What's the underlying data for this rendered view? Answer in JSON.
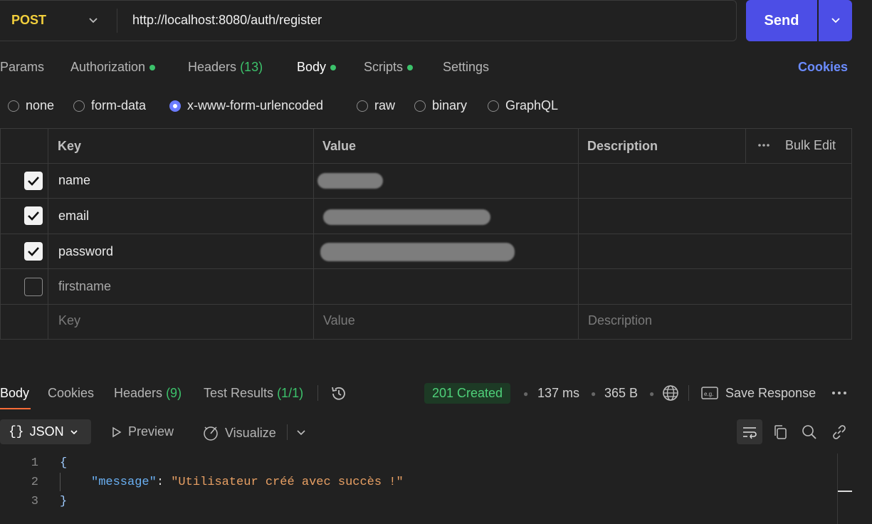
{
  "request": {
    "method": "POST",
    "url": "http://localhost:8080/auth/register",
    "send_label": "Send"
  },
  "request_tabs": [
    {
      "label": "Params"
    },
    {
      "label": "Authorization"
    },
    {
      "label": "Headers",
      "count": "(13)"
    },
    {
      "label": "Body"
    },
    {
      "label": "Scripts"
    },
    {
      "label": "Settings"
    }
  ],
  "cookies_label": "Cookies",
  "body_types": [
    "none",
    "form-data",
    "x-www-form-urlencoded",
    "raw",
    "binary",
    "GraphQL"
  ],
  "selected_body_type": "x-www-form-urlencoded",
  "table": {
    "headers": {
      "key": "Key",
      "value": "Value",
      "description": "Description",
      "bulk_edit": "Bulk Edit"
    },
    "rows": [
      {
        "checked": true,
        "key": "name"
      },
      {
        "checked": true,
        "key": "email"
      },
      {
        "checked": true,
        "key": "password"
      },
      {
        "checked": false,
        "key": "firstname"
      }
    ],
    "placeholders": {
      "key": "Key",
      "value": "Value",
      "description": "Description"
    }
  },
  "response": {
    "tabs": [
      {
        "label": "Body"
      },
      {
        "label": "Cookies"
      },
      {
        "label": "Headers",
        "count": "(9)"
      },
      {
        "label": "Test Results",
        "count": "(1/1)"
      }
    ],
    "status": "201 Created",
    "time": "137 ms",
    "size": "365 B",
    "save_label": "Save Response",
    "format": "JSON",
    "preview_label": "Preview",
    "visualize_label": "Visualize",
    "code": {
      "line_numbers": [
        "1",
        "2",
        "3"
      ],
      "open_brace": "{",
      "key": "\"message\"",
      "colon": ": ",
      "value": "\"Utilisateur créé avec succès !\"",
      "close_brace": "}"
    }
  },
  "colors": {
    "accent": "#4c4ee6",
    "green": "#3cc26b",
    "orange": "#ff6c37",
    "link": "#6b8cff"
  }
}
